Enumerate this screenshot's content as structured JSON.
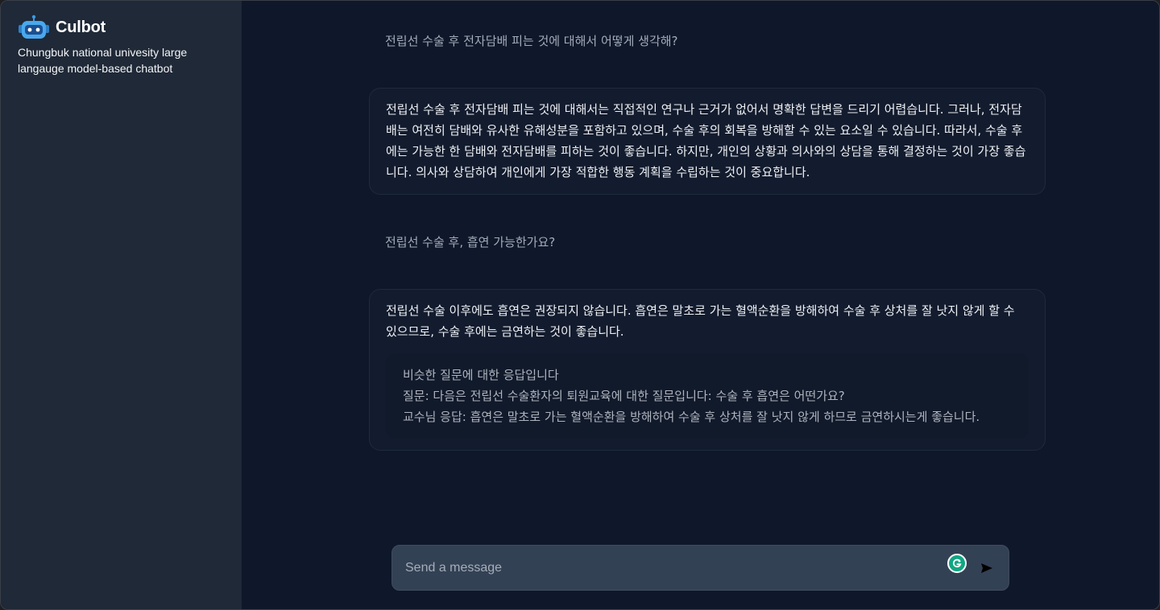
{
  "sidebar": {
    "title": "Culbot",
    "subtitle": "Chungbuk national univesity large langauge model-based chatbot",
    "logo_icon": "robot-icon"
  },
  "conversation": {
    "messages": [
      {
        "role": "user",
        "text": "전립선 수술 후 전자담배 피는 것에 대해서 어떻게 생각해?"
      },
      {
        "role": "assistant",
        "text": "전립선 수술 후 전자담배 피는 것에 대해서는 직접적인 연구나 근거가 없어서 명확한 답변을 드리기 어렵습니다. 그러나, 전자담배는 여전히 담배와 유사한 유해성분을 포함하고 있으며, 수술 후의 회복을 방해할 수 있는 요소일 수 있습니다. 따라서, 수술 후에는 가능한 한 담배와 전자담배를 피하는 것이 좋습니다. 하지만, 개인의 상황과 의사와의 상담을 통해 결정하는 것이 가장 좋습니다. 의사와 상담하여 개인에게 가장 적합한 행동 계획을 수립하는 것이 중요합니다."
      },
      {
        "role": "user",
        "text": "전립선 수술 후, 흡연 가능한가요?"
      },
      {
        "role": "assistant",
        "text": "전립선 수술 이후에도 흡연은 권장되지 않습니다. 흡연은 말초로 가는 혈액순환을 방해하여 수술 후 상처를 잘 낫지 않게 할 수 있으므로, 수술 후에는 금연하는 것이 좋습니다.",
        "similar": {
          "heading": "비슷한 질문에 대한 응답입니다",
          "question": "질문: 다음은 전립선 수술환자의 퇴원교육에 대한 질문입니다: 수술 후 흡연은 어떤가요?",
          "answer": "교수님 응답: 흡연은 말초로 가는 혈액순환을 방해하여 수술 후 상처를 잘 낫지 않게 하므로 금연하시는게 좋습니다."
        }
      }
    ]
  },
  "composer": {
    "placeholder": "Send a message",
    "extension_icon": "grammarly-icon",
    "send_icon": "send-icon"
  },
  "colors": {
    "main_bg": "#0f172a",
    "sidebar_bg": "#1f2937",
    "input_bg": "#334155",
    "accent_blue": "#3b9ae1"
  }
}
